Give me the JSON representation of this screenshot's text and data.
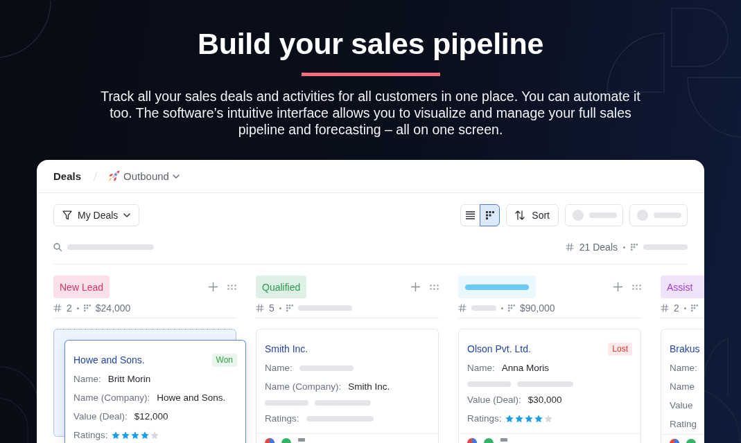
{
  "hero": {
    "title": "Build your sales pipeline",
    "text": "Track all your sales deals and activities for all customers in one place. You can automate it too. The software’s intuitive interface allows you to visualize and manage your full sales pipeline and forecasting – all on one screen."
  },
  "panel": {
    "title": "Deals",
    "view": "Outbound"
  },
  "toolbar": {
    "filter": "My Deals",
    "views": [
      {
        "kind": "list",
        "selected": false
      },
      {
        "kind": "board",
        "selected": true
      }
    ],
    "buttons": [
      {
        "kind": "sort",
        "label": "Sort"
      },
      {
        "kind": "skeleton"
      },
      {
        "kind": "skeleton"
      }
    ]
  },
  "summary": {
    "count": "21 Deals"
  },
  "columns": [
    {
      "tag": {
        "text": "New Lead",
        "loading": false
      },
      "color": "#d6336c",
      "clipped": false,
      "stats": [
        {
          "kind": "count",
          "text": "2",
          "loading": false
        },
        {
          "kind": "total",
          "text": "$24,000",
          "loading": false
        }
      ],
      "cards": [
        {
          "title": "Howe and Sons.",
          "dragging": true,
          "badge": {
            "text": "Won",
            "color": "#2f9e44"
          },
          "rows": [
            {
              "kind": "field",
              "label": "Name:",
              "value": "Britt Morin"
            },
            {
              "kind": "field",
              "label": "Name (Company):",
              "value": "Howe and Sons."
            },
            {
              "kind": "field",
              "label": "Value (Deal):",
              "value": "$12,000"
            },
            {
              "kind": "rating",
              "label": "Ratings:",
              "stars": 4
            }
          ]
        }
      ]
    },
    {
      "tag": {
        "text": "Qualified",
        "loading": false
      },
      "color": "#2b9a52",
      "clipped": false,
      "stats": [
        {
          "kind": "count",
          "text": "5",
          "loading": false
        },
        {
          "kind": "total",
          "loading": true
        }
      ],
      "cards": [
        {
          "title": "Smith Inc.",
          "dragging": false,
          "rows": [
            {
              "kind": "loading",
              "label": "Name:"
            },
            {
              "kind": "field",
              "label": "Name (Company):",
              "value": "Smith Inc."
            },
            {
              "kind": "skeleton"
            },
            {
              "kind": "loading",
              "label": "Ratings:"
            }
          ]
        }
      ]
    },
    {
      "tag": {
        "loading": true
      },
      "color": "#6cc8f5",
      "clipped": false,
      "stats": [
        {
          "kind": "count",
          "loading": true
        },
        {
          "kind": "total",
          "text": "$90,000",
          "loading": false
        }
      ],
      "cards": [
        {
          "title": "Olson Pvt. Ltd.",
          "dragging": false,
          "badge": {
            "text": "Lost",
            "color": "#e03131"
          },
          "rows": [
            {
              "kind": "field",
              "label": "Name:",
              "value": "Anna Moris"
            },
            {
              "kind": "skeleton"
            },
            {
              "kind": "field",
              "label": "Value (Deal):",
              "value": "$30,000"
            },
            {
              "kind": "rating",
              "label": "Ratings:",
              "stars": 4
            }
          ]
        }
      ]
    },
    {
      "tag": {
        "text": "Assist",
        "loading": false
      },
      "color": "#9b3fd6",
      "clipped": true,
      "stats": [
        {
          "kind": "count",
          "text": "2",
          "loading": false
        },
        {
          "kind": "total",
          "loading": false
        }
      ],
      "cards": [
        {
          "title": "Brakus",
          "dragging": false,
          "rows": [
            {
              "kind": "field",
              "label": "Name:"
            },
            {
              "kind": "field",
              "label": "Name"
            },
            {
              "kind": "field",
              "label": "Value"
            },
            {
              "kind": "field",
              "label": "Rating"
            }
          ]
        }
      ]
    }
  ]
}
